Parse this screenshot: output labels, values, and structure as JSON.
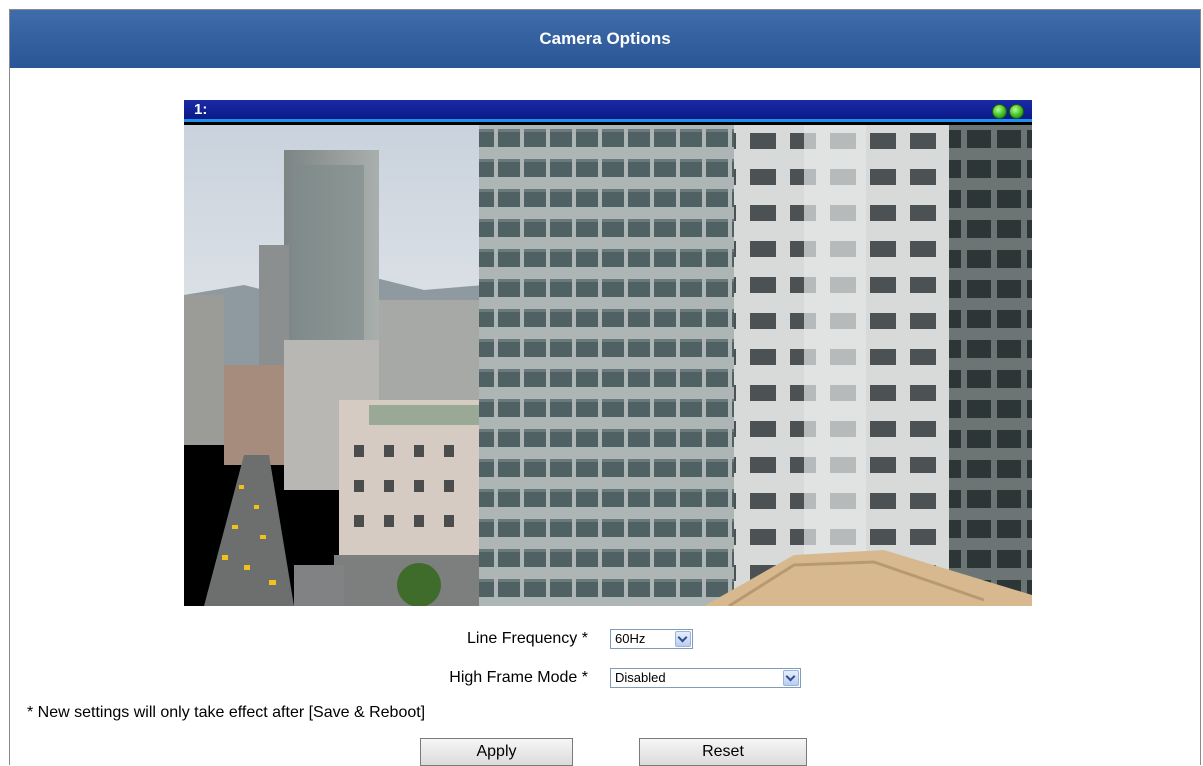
{
  "header": {
    "title": "Camera Options"
  },
  "video": {
    "channel_label": "1:",
    "status_icons": [
      "green-status-icon",
      "green-status-icon"
    ]
  },
  "form": {
    "line_frequency": {
      "label": "Line Frequency",
      "required_mark": "*",
      "value": "60Hz"
    },
    "high_frame_mode": {
      "label": "High Frame Mode",
      "required_mark": "*",
      "value": "Disabled"
    }
  },
  "note": "* New settings will only take effect after [Save & Reboot]",
  "buttons": {
    "apply": "Apply",
    "reset": "Reset"
  },
  "colors": {
    "title_bar": "#2f5b9c",
    "video_header": "#0f1f90",
    "status_green": "#33b51c"
  }
}
